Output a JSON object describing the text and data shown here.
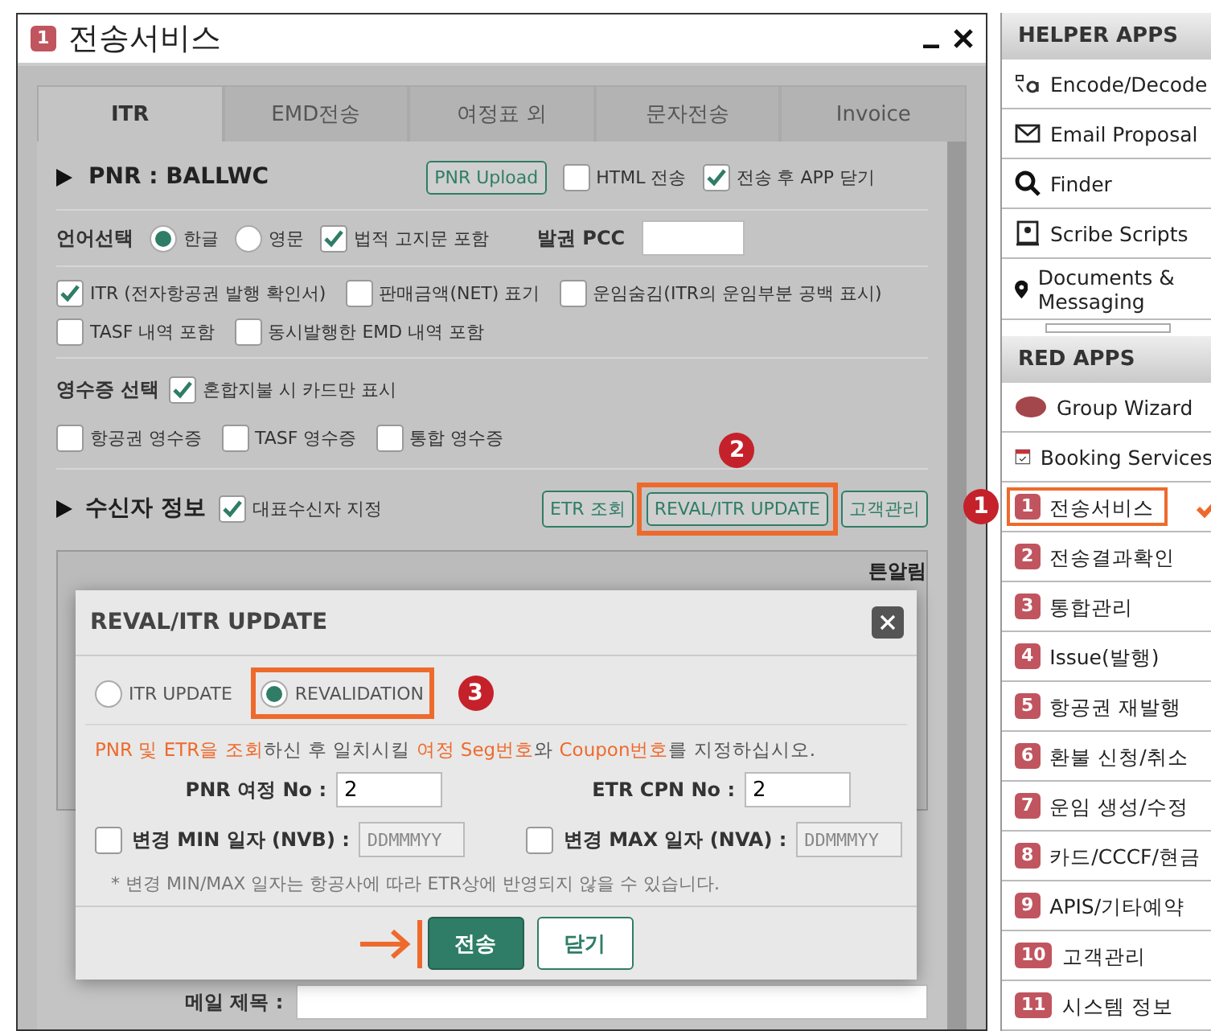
{
  "window": {
    "badge": "1",
    "title": "전송서비스"
  },
  "tabs": [
    {
      "label": "ITR",
      "selected": true
    },
    {
      "label": "EMD전송",
      "selected": false
    },
    {
      "label": "여정표 외",
      "selected": false
    },
    {
      "label": "문자전송",
      "selected": false
    },
    {
      "label": "Invoice",
      "selected": false
    }
  ],
  "pnr": {
    "heading": "PNR : BALLWC",
    "upload": "PNR Upload",
    "options": [
      {
        "label": "HTML 전송",
        "checked": false
      },
      {
        "label": "전송 후 APP 닫기",
        "checked": true
      }
    ]
  },
  "language": {
    "label": "언어선택",
    "options": [
      {
        "label": "한글",
        "selected": true
      },
      {
        "label": "영문",
        "selected": false
      }
    ],
    "legal": {
      "label": "법적 고지문 포함",
      "checked": true
    },
    "pcc_label": "발권 PCC"
  },
  "itr_options": [
    {
      "label": "ITR (전자항공권 발행 확인서)",
      "checked": true
    },
    {
      "label": "판매금액(NET) 표기",
      "checked": false
    },
    {
      "label": "운임숨김(ITR의 운임부분 공백 표시)",
      "checked": false
    },
    {
      "label": "TASF 내역 포함",
      "checked": false
    },
    {
      "label": "동시발행한 EMD 내역 포함",
      "checked": false
    }
  ],
  "receipt": {
    "label": "영수증 선택",
    "card_only": {
      "label": "혼합지불 시 카드만 표시",
      "checked": true
    },
    "options": [
      {
        "label": "항공권 영수증",
        "checked": false
      },
      {
        "label": "TASF 영수증",
        "checked": false
      },
      {
        "label": "통합 영수증",
        "checked": false
      }
    ]
  },
  "recipient": {
    "heading": "수신자 정보",
    "representative": {
      "label": "대표수신자 지정",
      "checked": true
    },
    "buttons": [
      {
        "label": "ETR 조회",
        "highlighted": false
      },
      {
        "label": "REVAL/ITR UPDATE",
        "highlighted": true,
        "callout": "2"
      },
      {
        "label": "고객관리",
        "highlighted": false
      }
    ],
    "column_fragment": "튼알림"
  },
  "mail": {
    "label": "메일 제목 :"
  },
  "dialog": {
    "title": "REVAL/ITR UPDATE",
    "modes": [
      {
        "label": "ITR UPDATE",
        "selected": false,
        "highlighted": false
      },
      {
        "label": "REVALIDATION",
        "selected": true,
        "highlighted": true,
        "callout": "3"
      }
    ],
    "instruction": "**PNR 및 ETR을 조회**하신 후 일치시킬 **여정 Seg번호**와 **Coupon번호**를 지정하십시오.",
    "pnr_seg": {
      "label": "PNR 여정 No :",
      "value": "2"
    },
    "etr_cpn": {
      "label": "ETR CPN No :",
      "value": "2"
    },
    "min_date": {
      "label": "변경 MIN 일자 (NVB) :",
      "checked": false,
      "placeholder": "DDMMMYY"
    },
    "max_date": {
      "label": "변경 MAX 일자 (NVA) :",
      "checked": false,
      "placeholder": "DDMMMYY"
    },
    "note": "* 변경 MIN/MAX 일자는 항공사에 따라 ETR상에 반영되지 않을 수 있습니다.",
    "send": {
      "label": "전송",
      "pointed": true
    },
    "close": "닫기"
  },
  "sidebar": {
    "helper_title": "HELPER APPS",
    "helper_items": [
      {
        "label": "Encode/Decode",
        "kind": "encode"
      },
      {
        "label": "Email Proposal",
        "kind": "mail"
      },
      {
        "label": "Finder",
        "kind": "search"
      },
      {
        "label": "Scribe Scripts",
        "kind": "script"
      },
      {
        "label": "Documents & Messaging",
        "kind": "pin"
      }
    ],
    "red_title": "RED APPS",
    "red_items": [
      {
        "label": "Group Wizard",
        "kind": "group"
      },
      {
        "label": "Booking Services",
        "kind": "calendar"
      }
    ],
    "numbered": [
      {
        "number": "1",
        "label": "전송서비스",
        "highlighted": true,
        "callout": "1"
      },
      {
        "number": "2",
        "label": "전송결과확인",
        "highlighted": false
      },
      {
        "number": "3",
        "label": "통합관리",
        "highlighted": false
      },
      {
        "number": "4",
        "label": "Issue(발행)",
        "highlighted": false
      },
      {
        "number": "5",
        "label": "항공권 재발행",
        "highlighted": false
      },
      {
        "number": "6",
        "label": "환불 신청/취소",
        "highlighted": false
      },
      {
        "number": "7",
        "label": "운임 생성/수정",
        "highlighted": false
      },
      {
        "number": "8",
        "label": "카드/CCCF/현금",
        "highlighted": false
      },
      {
        "number": "9",
        "label": "APIS/기타예약",
        "highlighted": false
      },
      {
        "number": "10",
        "label": "고객관리",
        "highlighted": false
      },
      {
        "number": "11",
        "label": "시스템 정보",
        "highlighted": false
      }
    ]
  }
}
